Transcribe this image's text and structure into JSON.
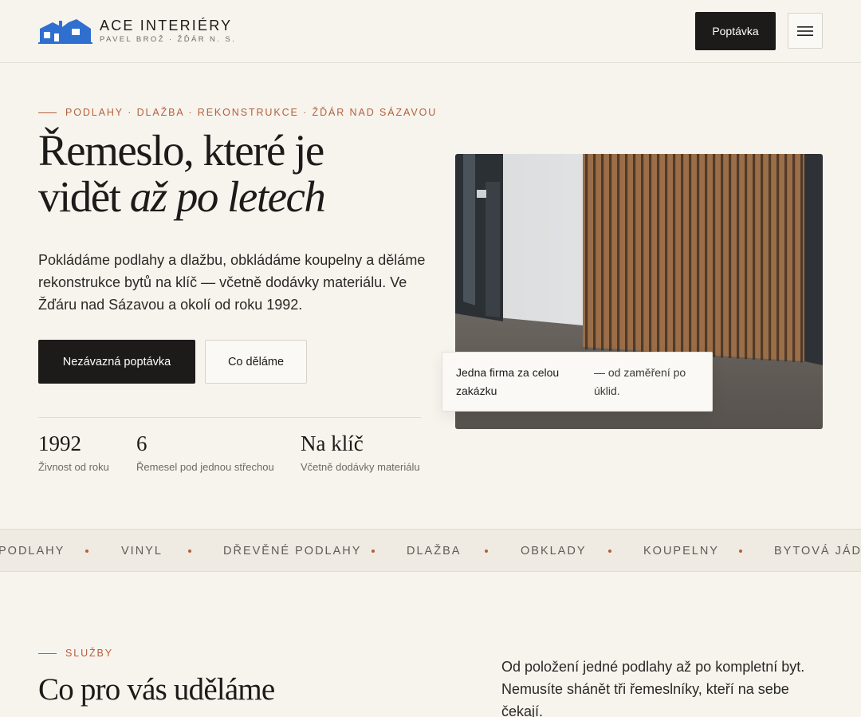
{
  "header": {
    "brand_name": "ACE INTERIÉRY",
    "brand_sub": "PAVEL BROŽ · ŽĎÁR N. S.",
    "logo_icon": "house-logo-icon",
    "cta_label": "Poptávka",
    "menu_icon": "hamburger-menu-icon"
  },
  "hero": {
    "eyebrow": "PODLAHY · DLAŽBA · REKONSTRUKCE · ŽĎÁR NAD SÁZAVOU",
    "title_line1": "Řemeslo, které je",
    "title_line2_plain": "vidět ",
    "title_line2_italic": "až po letech",
    "description": "Pokládáme podlahy a dlažbu, obkládáme koupelny a děláme rekonstrukce bytů na klíč — včetně dodávky materiálu. Ve Žďáru nad Sázavou a okolí od roku 1992.",
    "primary_button": "Nezávazná poptávka",
    "secondary_button": "Co děláme",
    "stats": [
      {
        "value": "1992",
        "label": "Živnost od roku"
      },
      {
        "value": "6",
        "label": "Řemesel pod jednou střechou"
      },
      {
        "value": "Na klíč",
        "label": "Včetně dodávky materiálu"
      }
    ],
    "caption_strong": "Jedna firma za celou zakázku",
    "caption_rest": "— od zaměření po úklid."
  },
  "marquee": {
    "items": [
      "PODLAHY",
      "VINYL",
      "DŘEVĚNÉ PODLAHY",
      "DLAŽBA",
      "OBKLADY",
      "KOUPELNY",
      "BYTOVÁ JÁDRA"
    ],
    "accent": "#b45f3a"
  },
  "services": {
    "eyebrow": "SLUŽBY",
    "title": "Co pro vás uděláme",
    "description": "Od položení jedné podlahy až po kompletní byt. Nemusíte shánět tři řemeslníky, kteří na sebe čekají."
  },
  "colors": {
    "background": "#f7f4ee",
    "accent": "#b45f3a",
    "dark": "#1c1b19",
    "logo_blue": "#2f6fd0"
  }
}
